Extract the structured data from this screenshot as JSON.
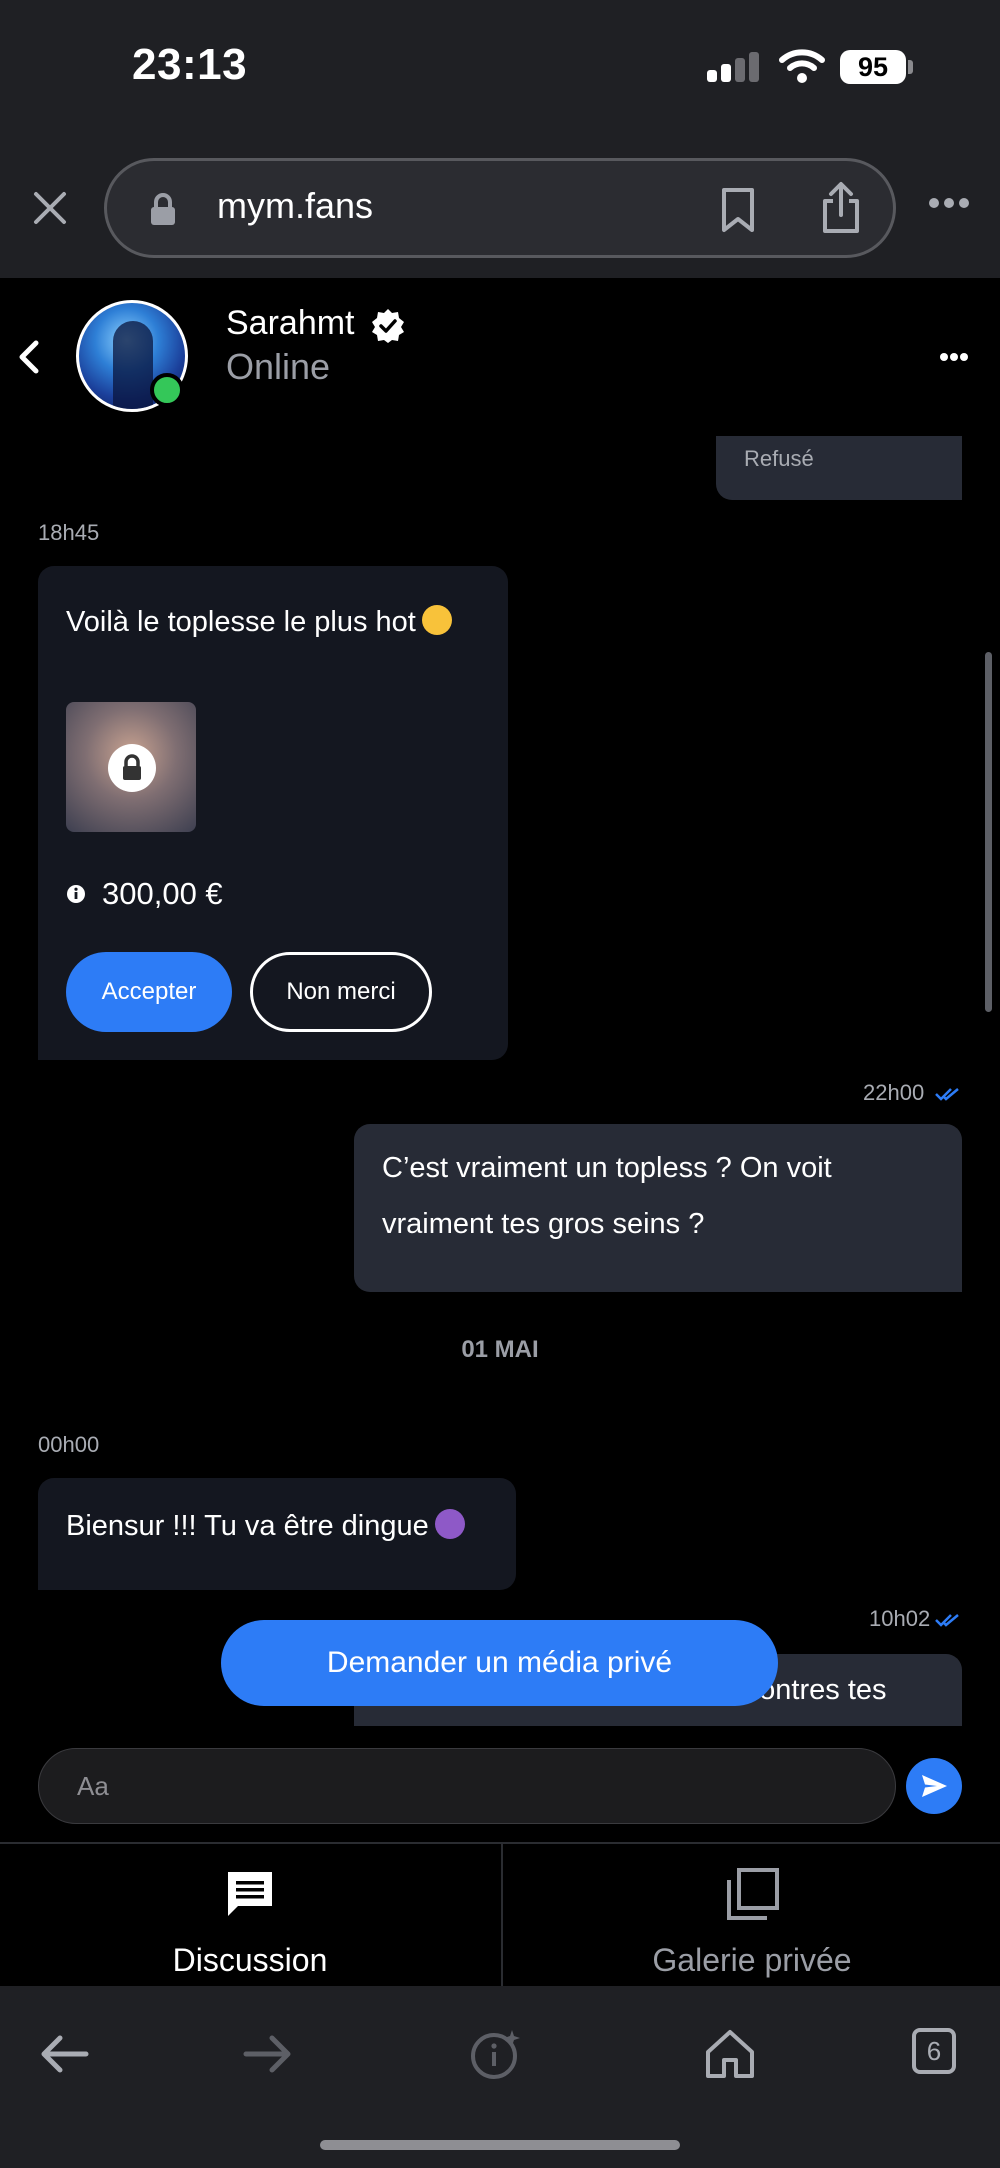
{
  "status_bar": {
    "time": "23:13",
    "battery": "95"
  },
  "browser": {
    "url": "mym.fans"
  },
  "chat_header": {
    "name": "Sarahmt",
    "status": "Online"
  },
  "messages": {
    "refused_label": "Refusé",
    "offer": {
      "time": "18h45",
      "text": "Voilà le toplesse le plus hot",
      "price": "300,00 €",
      "accept_label": "Accepter",
      "decline_label": "Non merci"
    },
    "question": {
      "time": "22h00",
      "text": "C’est vraiment un topless ? On voit vraiment tes gros seins ?"
    },
    "date_separator": "01 MAI",
    "reply": {
      "time": "00h00",
      "text": "Biensur !!! Tu va être dingue"
    },
    "last": {
      "time": "10h02",
      "text": "C’est vrai, genre là enfin tu montres tes"
    }
  },
  "request_media_label": "Demander un média privé",
  "composer": {
    "placeholder": "Aa"
  },
  "tabs": [
    {
      "label": "Discussion",
      "icon": "chat-icon",
      "active": true
    },
    {
      "label": "Galerie privée",
      "icon": "gallery-icon",
      "active": false
    }
  ],
  "safari_toolbar": {
    "tabs_count": "6"
  },
  "colors": {
    "accent": "#2d7cf6",
    "online": "#34c759",
    "incoming_bubble": "#141720",
    "outgoing_bubble": "#272b36",
    "chrome": "#1f2024"
  }
}
